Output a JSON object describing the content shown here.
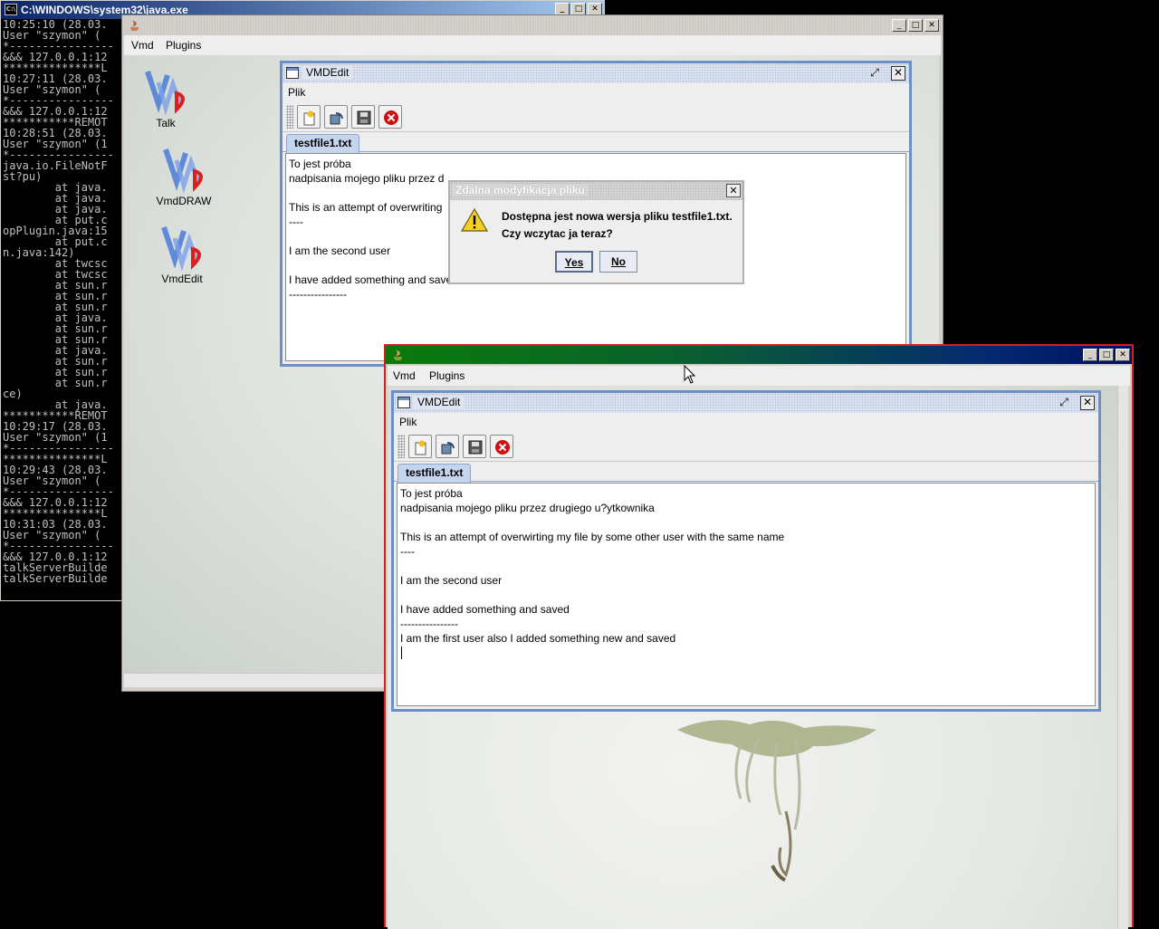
{
  "console": {
    "title": "C:\\WINDOWS\\system32\\java.exe",
    "lines": [
      "10:25:10 (28.03.",
      "User \"szymon\" (",
      "*----------------",
      "&&& 127.0.0.1:12",
      "***************L",
      "10:27:11 (28.03.",
      "User \"szymon\" (",
      "*----------------",
      "&&& 127.0.0.1:12",
      "***********REMOT",
      "10:28:51 (28.03.",
      "User \"szymon\" (1",
      "*----------------",
      "java.io.FileNotF",
      "st?pu)",
      "        at java.",
      "        at java.",
      "        at java.",
      "        at put.c",
      "opPlugin.java:15",
      "        at put.c",
      "n.java:142)",
      "        at twcsc",
      "        at twcsc",
      "        at sun.r",
      "        at sun.r",
      "        at sun.r",
      "        at java.",
      "        at sun.r",
      "        at sun.r",
      "        at java.",
      "        at sun.r",
      "        at sun.r",
      "        at sun.r",
      "ce)",
      "        at java.",
      "***********REMOT",
      "10:29:17 (28.03.",
      "User \"szymon\" (1",
      "*----------------",
      "***************L",
      "10:29:43 (28.03.",
      "User \"szymon\" (",
      "*----------------",
      "&&& 127.0.0.1:12",
      "***************L",
      "10:31:03 (28.03.",
      "User \"szymon\" (",
      "*----------------",
      "&&& 127.0.0.1:12",
      "talkServerBuilde",
      "talkServerBuilde"
    ]
  },
  "frame1": {
    "menu": [
      "Vmd",
      "Plugins"
    ],
    "desktop_icons": [
      {
        "label": "Talk",
        "icon": "vmd-logo-icon"
      },
      {
        "label": "VmdDRAW",
        "icon": "vmd-logo-icon"
      },
      {
        "label": "VmdEdit",
        "icon": "vmd-logo-icon"
      }
    ],
    "editor_window": {
      "title": "VMDEdit",
      "menu": "Plik",
      "tab": "testfile1.txt",
      "lines": [
        "To jest próba",
        "nadpisania mojego pliku przez d",
        "",
        "This is an attempt of overwriting",
        "----",
        "",
        "I am the second user",
        "",
        "I have added something and saved",
        "----------------"
      ]
    }
  },
  "dialog": {
    "title": "Zdalna modyfikacja pliku",
    "message_line1": "Dostępna jest nowa wersja pliku testfile1.txt.",
    "message_line2": "Czy wczytac ja teraz?",
    "yes": "Yes",
    "no": "No",
    "icon": "warning-icon"
  },
  "frame2": {
    "menu": [
      "Vmd",
      "Plugins"
    ],
    "editor_window": {
      "title": "VMDEdit",
      "menu": "Plik",
      "tab": "testfile1.txt",
      "lines": [
        "To jest próba",
        "nadpisania mojego pliku przez drugiego u?ytkownika",
        "",
        "This is an attempt of overwirting my file by some other user with the same name",
        "----",
        "",
        "I am the second user",
        "",
        "I have added something and saved",
        "----------------",
        "I am the first user also I added something new and saved",
        ""
      ]
    }
  },
  "toolbar_icons": [
    "new-file-icon",
    "reload-icon",
    "save-icon",
    "close-red-icon"
  ],
  "colors": {
    "accent": "#6d8fc8",
    "frame2_border": "#d02020",
    "close_red": "#d01010"
  }
}
